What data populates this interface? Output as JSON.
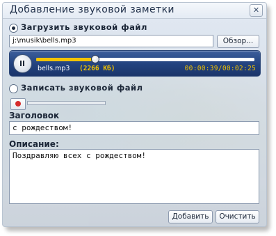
{
  "window": {
    "title": "Добавление звуковой заметки",
    "close_glyph": "✕"
  },
  "upload": {
    "label": "Загрузить звуковой файл",
    "selected": true,
    "path": "j:\\musik\\bells.mp3",
    "browse_label": "Обзор..."
  },
  "player": {
    "file_name": "bells.mp3",
    "file_size": "(2266 Кб)",
    "time": "00:00:39/00:02:25",
    "progress": 0.27,
    "colors": {
      "bar": "#22427e",
      "accent": "#f2c300"
    }
  },
  "record": {
    "label": "Записать звуковой файл",
    "selected": false,
    "record_icon": "record-dot-icon"
  },
  "heading": {
    "label": "Заголовок",
    "value": "с рождеством!"
  },
  "description": {
    "label": "Описание:",
    "value": "Поздравляю всех с рождеством!"
  },
  "actions": {
    "add_label": "Добавить",
    "clear_label": "Очистить"
  }
}
